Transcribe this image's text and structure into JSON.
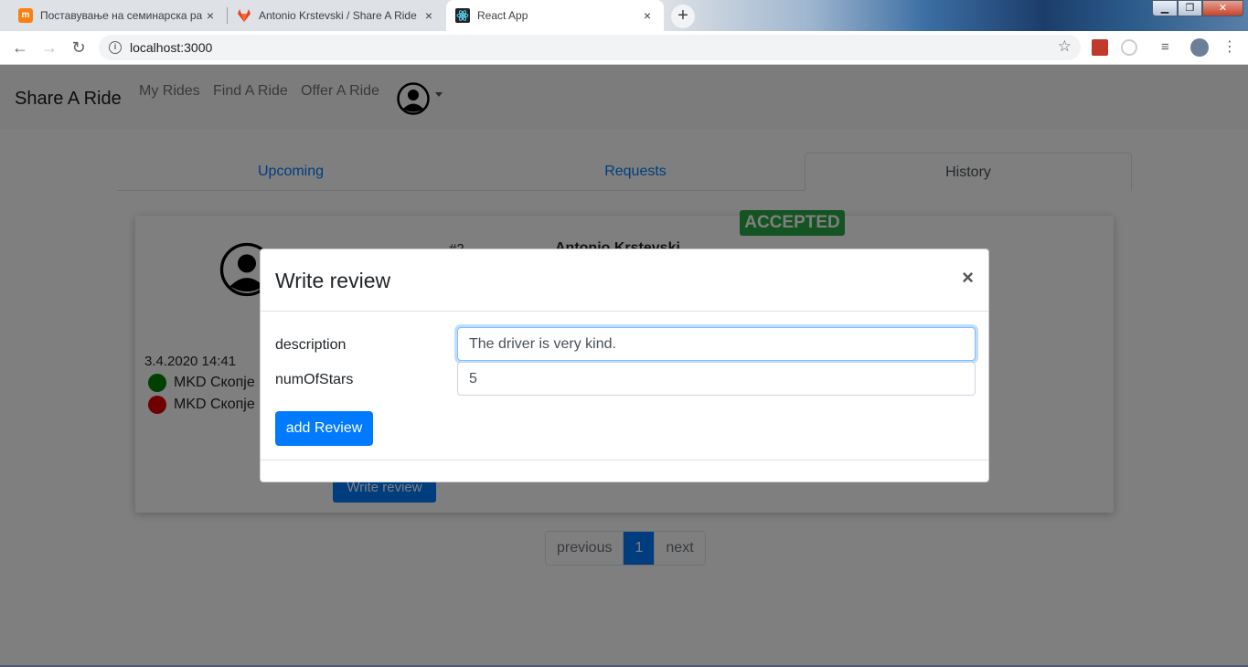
{
  "browser": {
    "tabs": [
      {
        "title": "Поставување на семинарска ра",
        "icon": "moodle-icon"
      },
      {
        "title": "Antonio Krstevski / Share A Ride",
        "icon": "gitlab-icon"
      },
      {
        "title": "React App",
        "icon": "react-icon"
      }
    ],
    "url": "localhost:3000",
    "colors": {
      "tab_strip": "#dee1e6"
    }
  },
  "app": {
    "brand": "Share A Ride",
    "nav": {
      "my_rides": "My Rides",
      "find_ride": "Find A Ride",
      "offer_ride": "Offer A Ride"
    },
    "tabs": {
      "upcoming": "Upcoming",
      "requests": "Requests",
      "history": "History"
    },
    "ride": {
      "status": "ACCEPTED",
      "number": "#2",
      "driver": "Antonio Krstevski",
      "datetime": "3.4.2020 14:41",
      "from": "MKD Скопје",
      "to": "MKD Скопје",
      "write_review": "Write review"
    },
    "pagination": {
      "previous": "previous",
      "current": "1",
      "next": "next"
    },
    "colors": {
      "primary": "#007bff",
      "success": "#28a745",
      "start_dot": "#008000",
      "end_dot": "#e00000"
    }
  },
  "modal": {
    "title": "Write review",
    "close": "×",
    "description_label": "description",
    "description_value": "The driver is very kind.",
    "stars_label": "numOfStars",
    "stars_value": "5",
    "submit": "add Review"
  }
}
